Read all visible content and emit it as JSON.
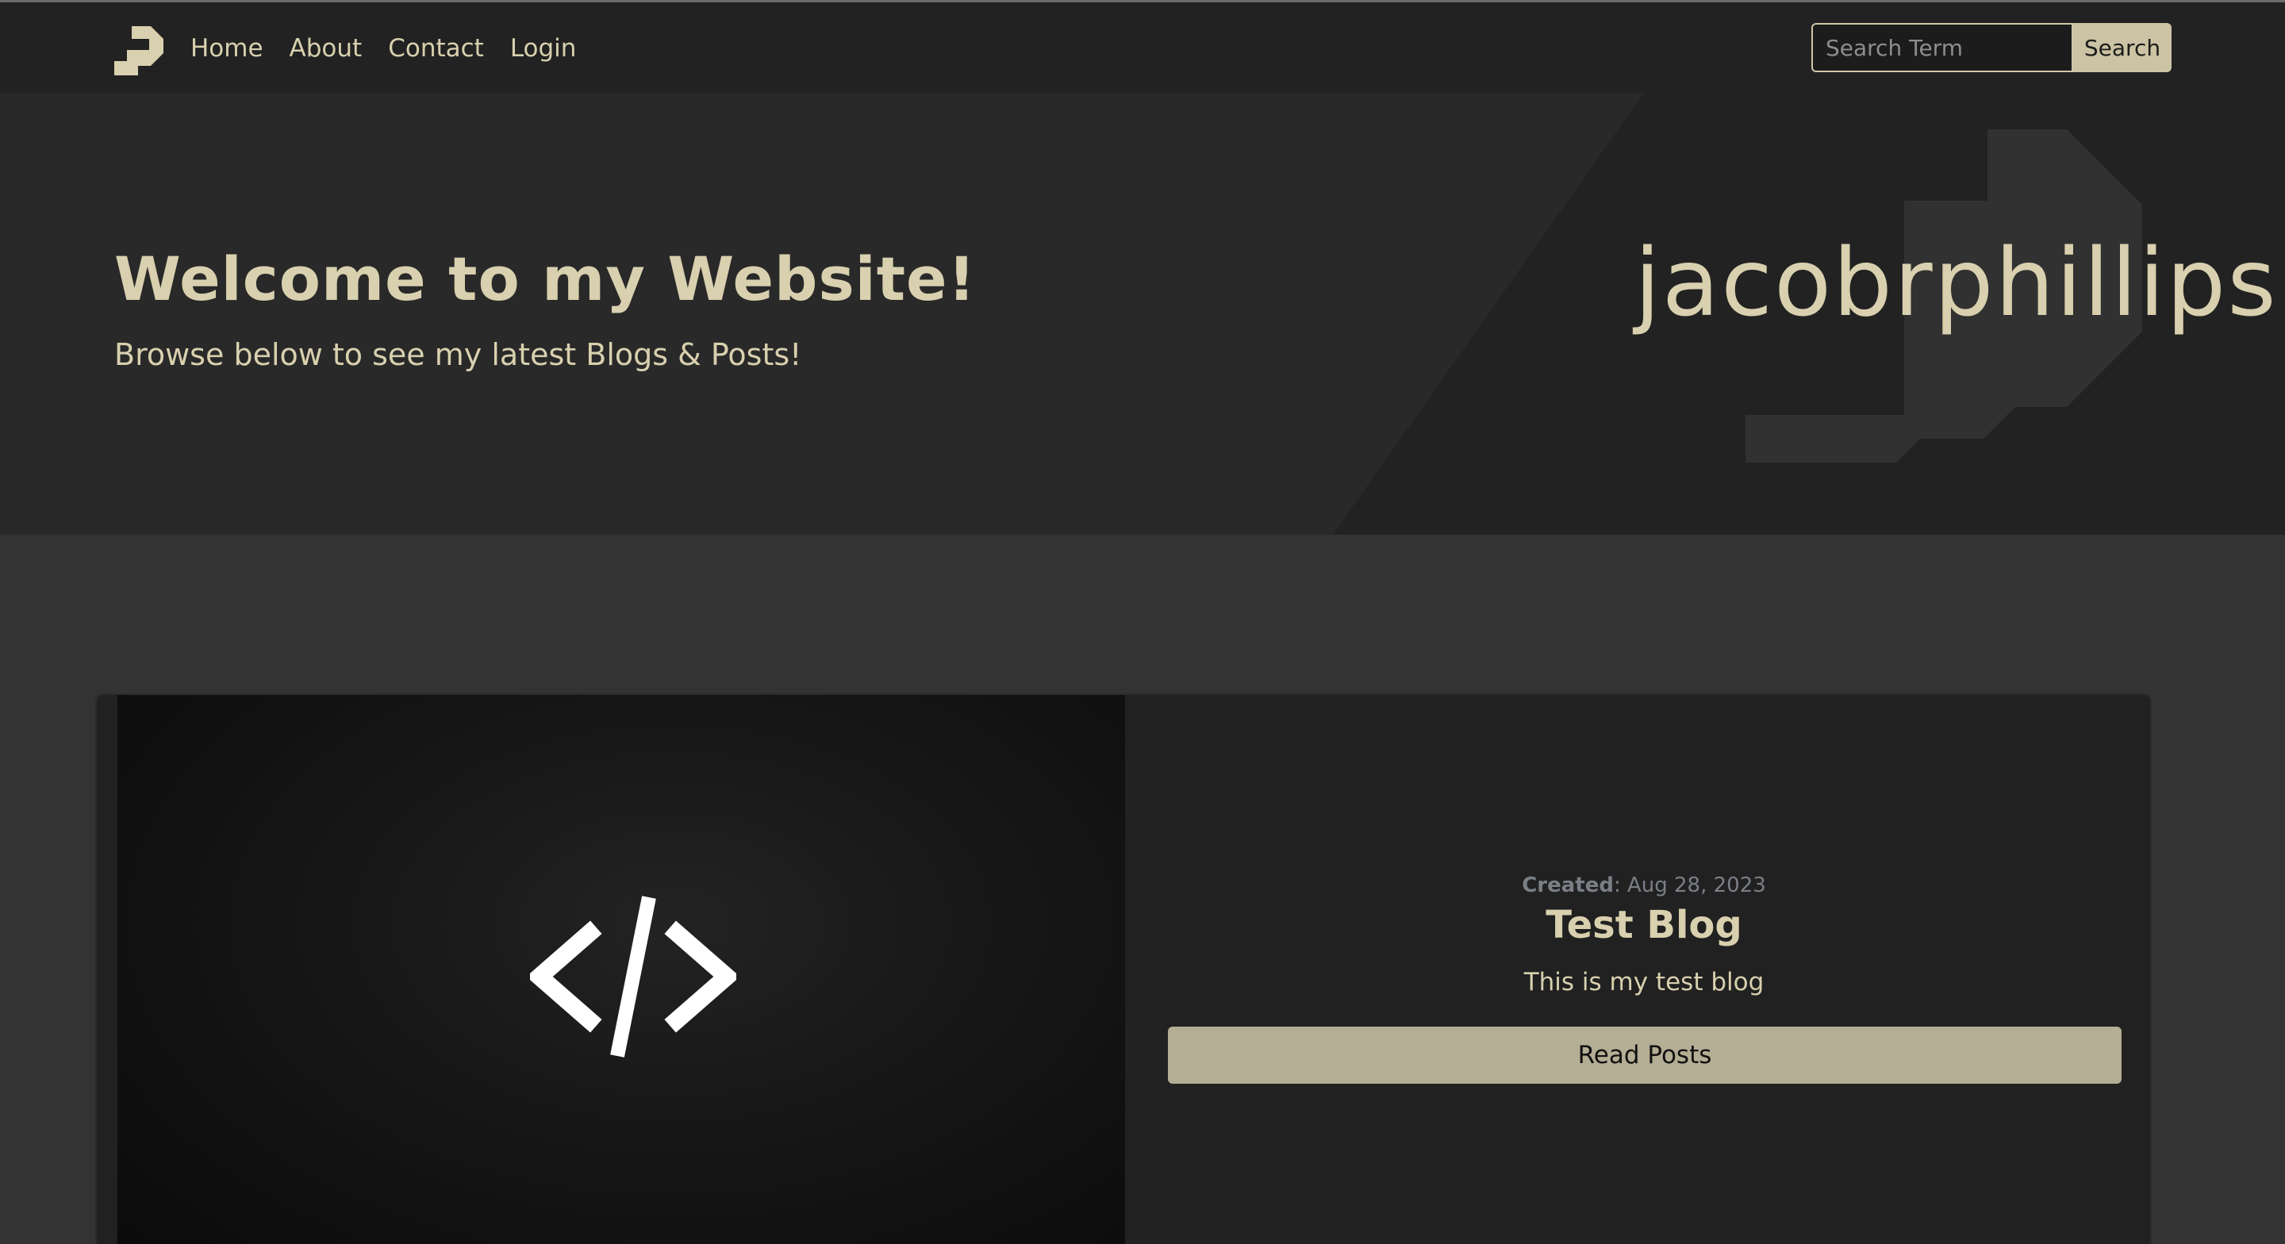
{
  "navbar": {
    "logo_icon": "jp-monogram-icon",
    "links": [
      "Home",
      "About",
      "Contact",
      "Login"
    ],
    "search": {
      "placeholder": "Search Term",
      "value": "",
      "button_label": "Search"
    }
  },
  "hero": {
    "title": "Welcome to my Website!",
    "subtitle": "Browse below to see my latest Blogs & Posts!",
    "brand_text": "jacobrphillips"
  },
  "card": {
    "image_icon": "code-brackets-icon",
    "created_label": "Created",
    "created_date": ": Aug 28, 2023",
    "title": "Test Blog",
    "description": "This is my test blog",
    "button_label": "Read Posts"
  },
  "colors": {
    "accent": "#d8d0ae",
    "button": "#b3ae94",
    "page_bg": "#333333",
    "nav_bg": "#222222"
  }
}
